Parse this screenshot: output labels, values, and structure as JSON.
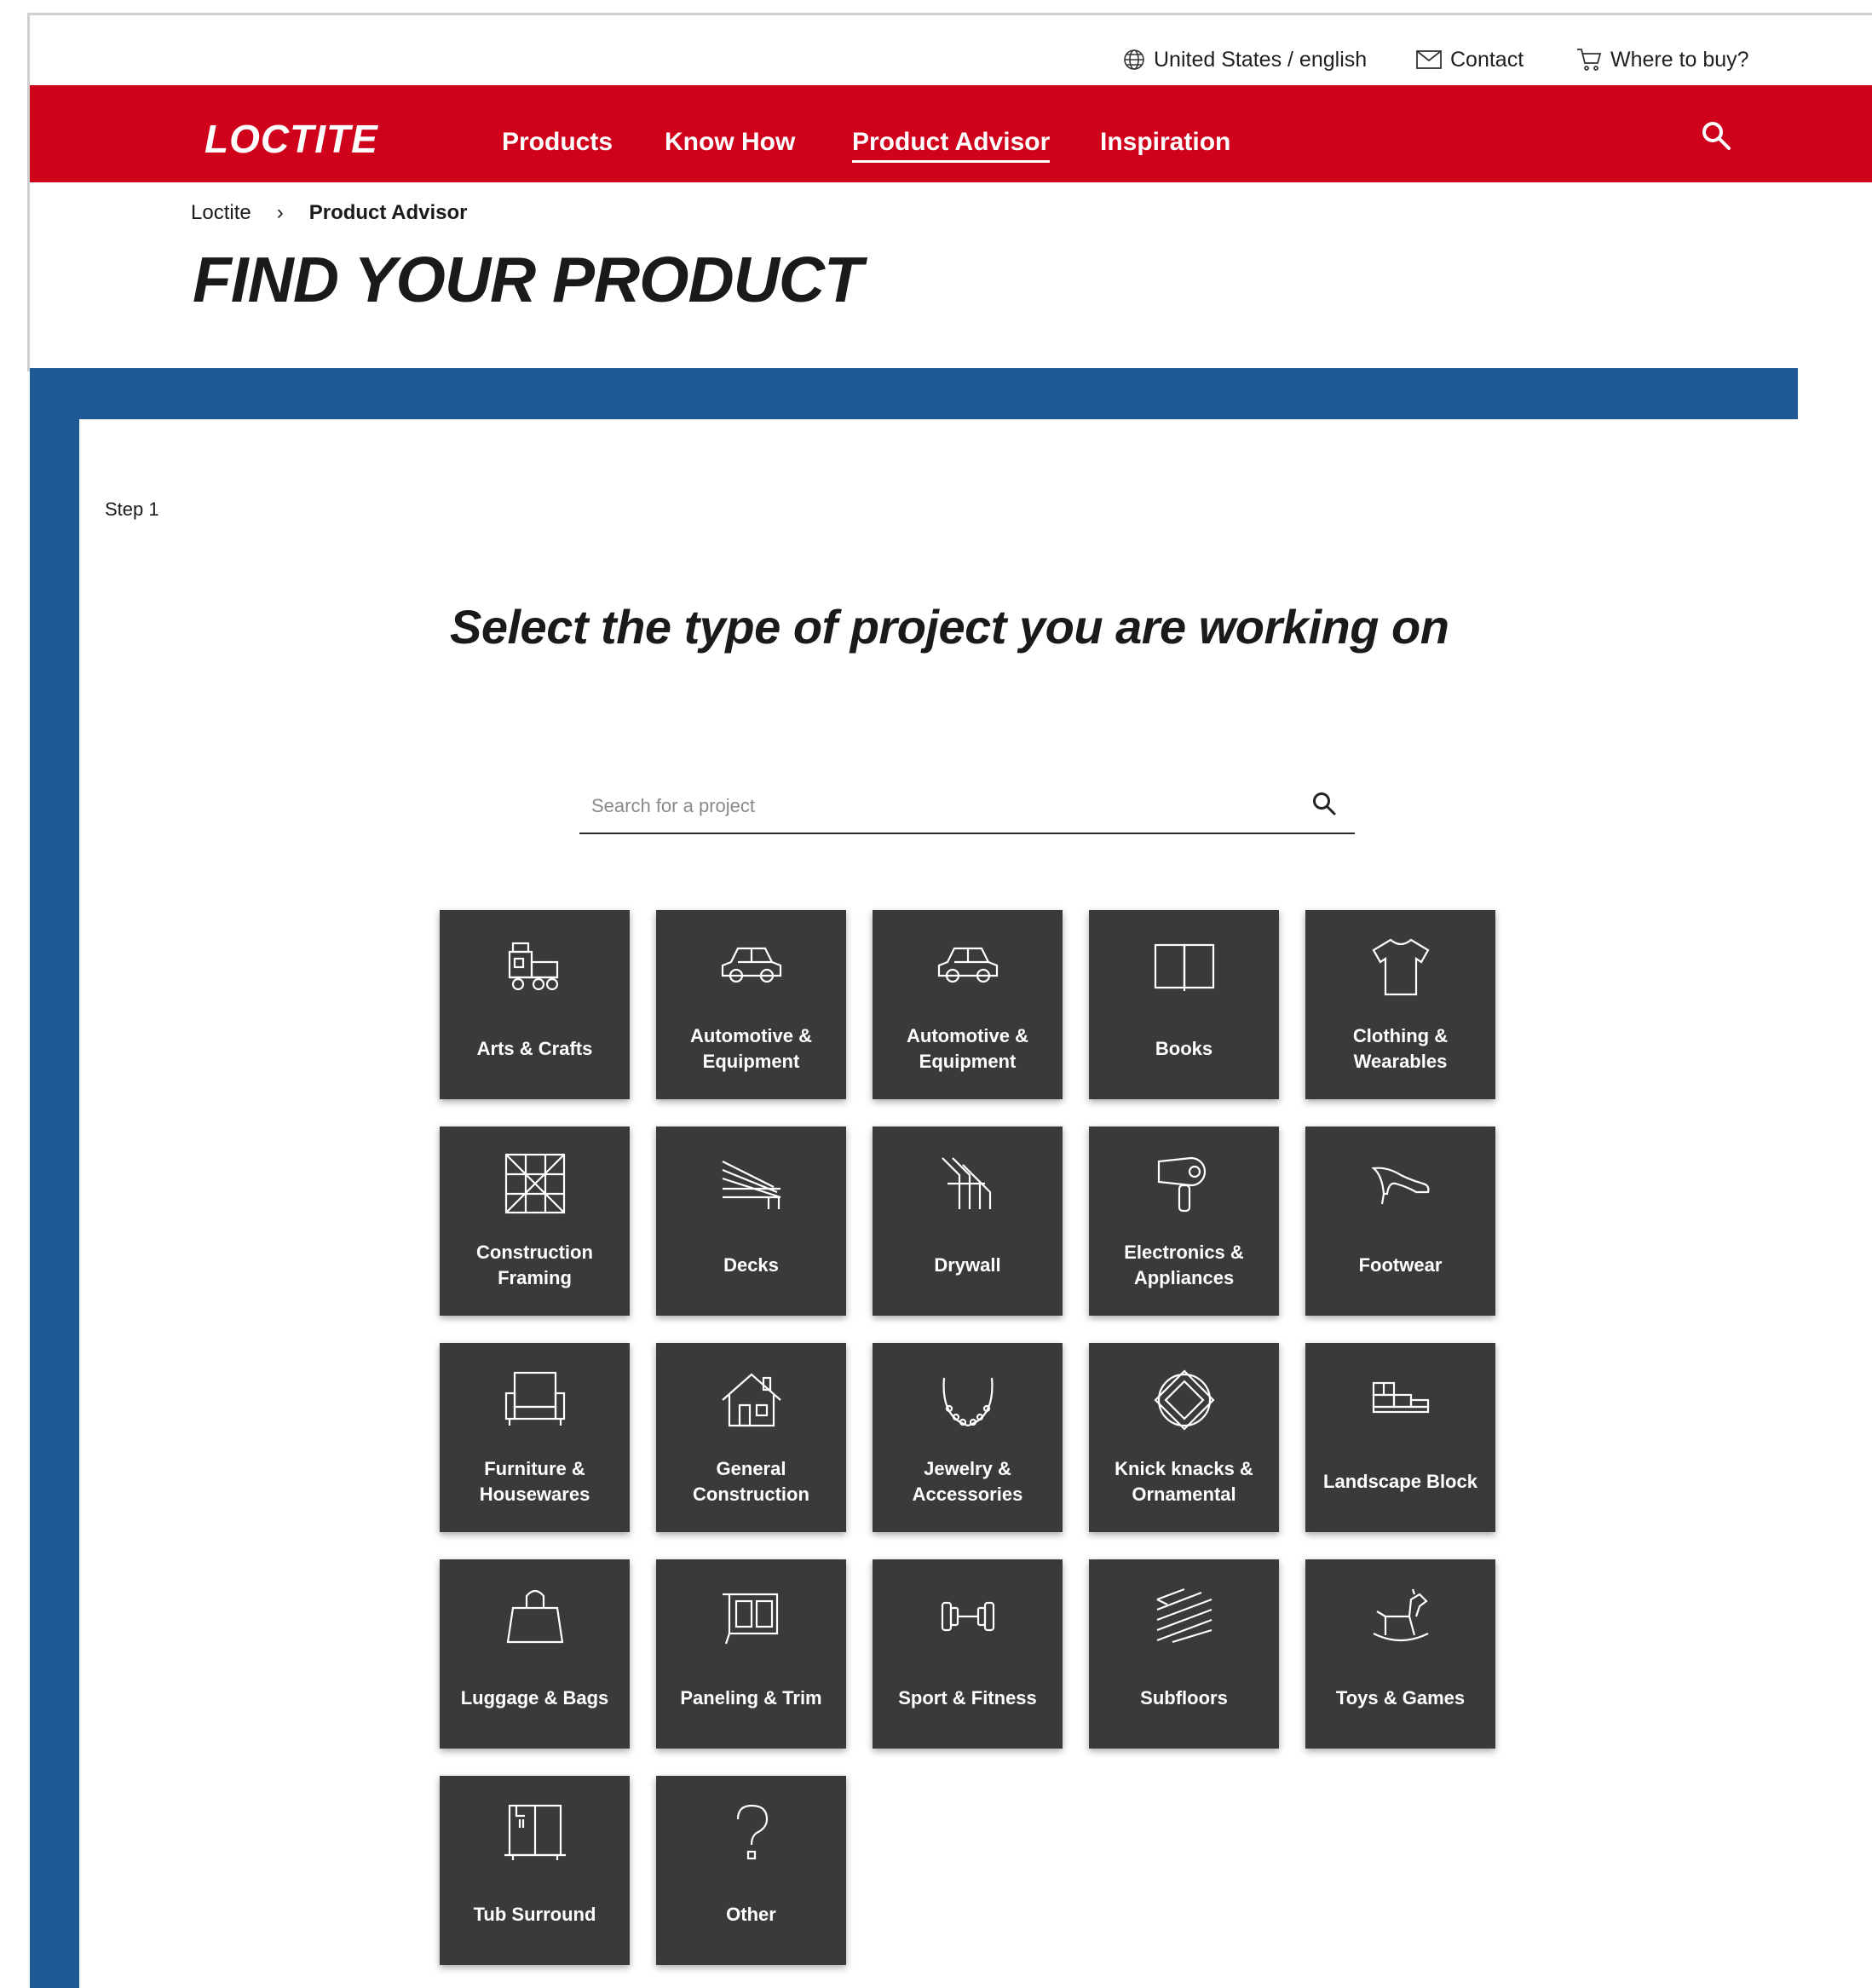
{
  "utility": {
    "region": "United States / english",
    "contact": "Contact",
    "where_to_buy": "Where to buy?"
  },
  "nav": {
    "logo": "LOCTITE",
    "links": [
      "Products",
      "Know How",
      "Product Advisor",
      "Inspiration"
    ],
    "active": "Product Advisor"
  },
  "breadcrumb": {
    "home": "Loctite",
    "separator": "›",
    "current": "Product Advisor"
  },
  "page_title": "FIND YOUR PRODUCT",
  "step": "Step 1",
  "question": "Select the type of project you are working on",
  "search": {
    "placeholder": "Search for a project"
  },
  "tiles": [
    {
      "label": "Arts & Crafts",
      "icon": "toy-train-icon"
    },
    {
      "label": "Automotive & Equipment",
      "icon": "car-icon"
    },
    {
      "label": "Automotive & Equipment",
      "icon": "car-icon"
    },
    {
      "label": "Books",
      "icon": "open-book-icon"
    },
    {
      "label": "Clothing & Wearables",
      "icon": "tshirt-icon"
    },
    {
      "label": "Construction Framing",
      "icon": "framing-grid-icon"
    },
    {
      "label": "Decks",
      "icon": "deck-boards-icon"
    },
    {
      "label": "Drywall",
      "icon": "drywall-icon"
    },
    {
      "label": "Electronics & Appliances",
      "icon": "hair-dryer-icon"
    },
    {
      "label": "Footwear",
      "icon": "high-heel-icon"
    },
    {
      "label": "Furniture & Housewares",
      "icon": "armchair-icon"
    },
    {
      "label": "General Construction",
      "icon": "house-icon"
    },
    {
      "label": "Jewelry & Accessories",
      "icon": "necklace-icon"
    },
    {
      "label": "Knick knacks & Ornamental",
      "icon": "ornament-icon"
    },
    {
      "label": "Landscape Block",
      "icon": "bricks-icon"
    },
    {
      "label": "Luggage & Bags",
      "icon": "bag-icon"
    },
    {
      "label": "Paneling & Trim",
      "icon": "panel-icon"
    },
    {
      "label": "Sport & Fitness",
      "icon": "dumbbell-icon"
    },
    {
      "label": "Subfloors",
      "icon": "subfloor-icon"
    },
    {
      "label": "Toys & Games",
      "icon": "rocking-horse-icon"
    },
    {
      "label": "Tub Surround",
      "icon": "shower-icon"
    },
    {
      "label": "Other",
      "icon": "question-mark-icon"
    }
  ],
  "colors": {
    "brand_red": "#d0021b",
    "band_blue": "#1f5a96",
    "tile_bg": "#3a3a3c"
  }
}
